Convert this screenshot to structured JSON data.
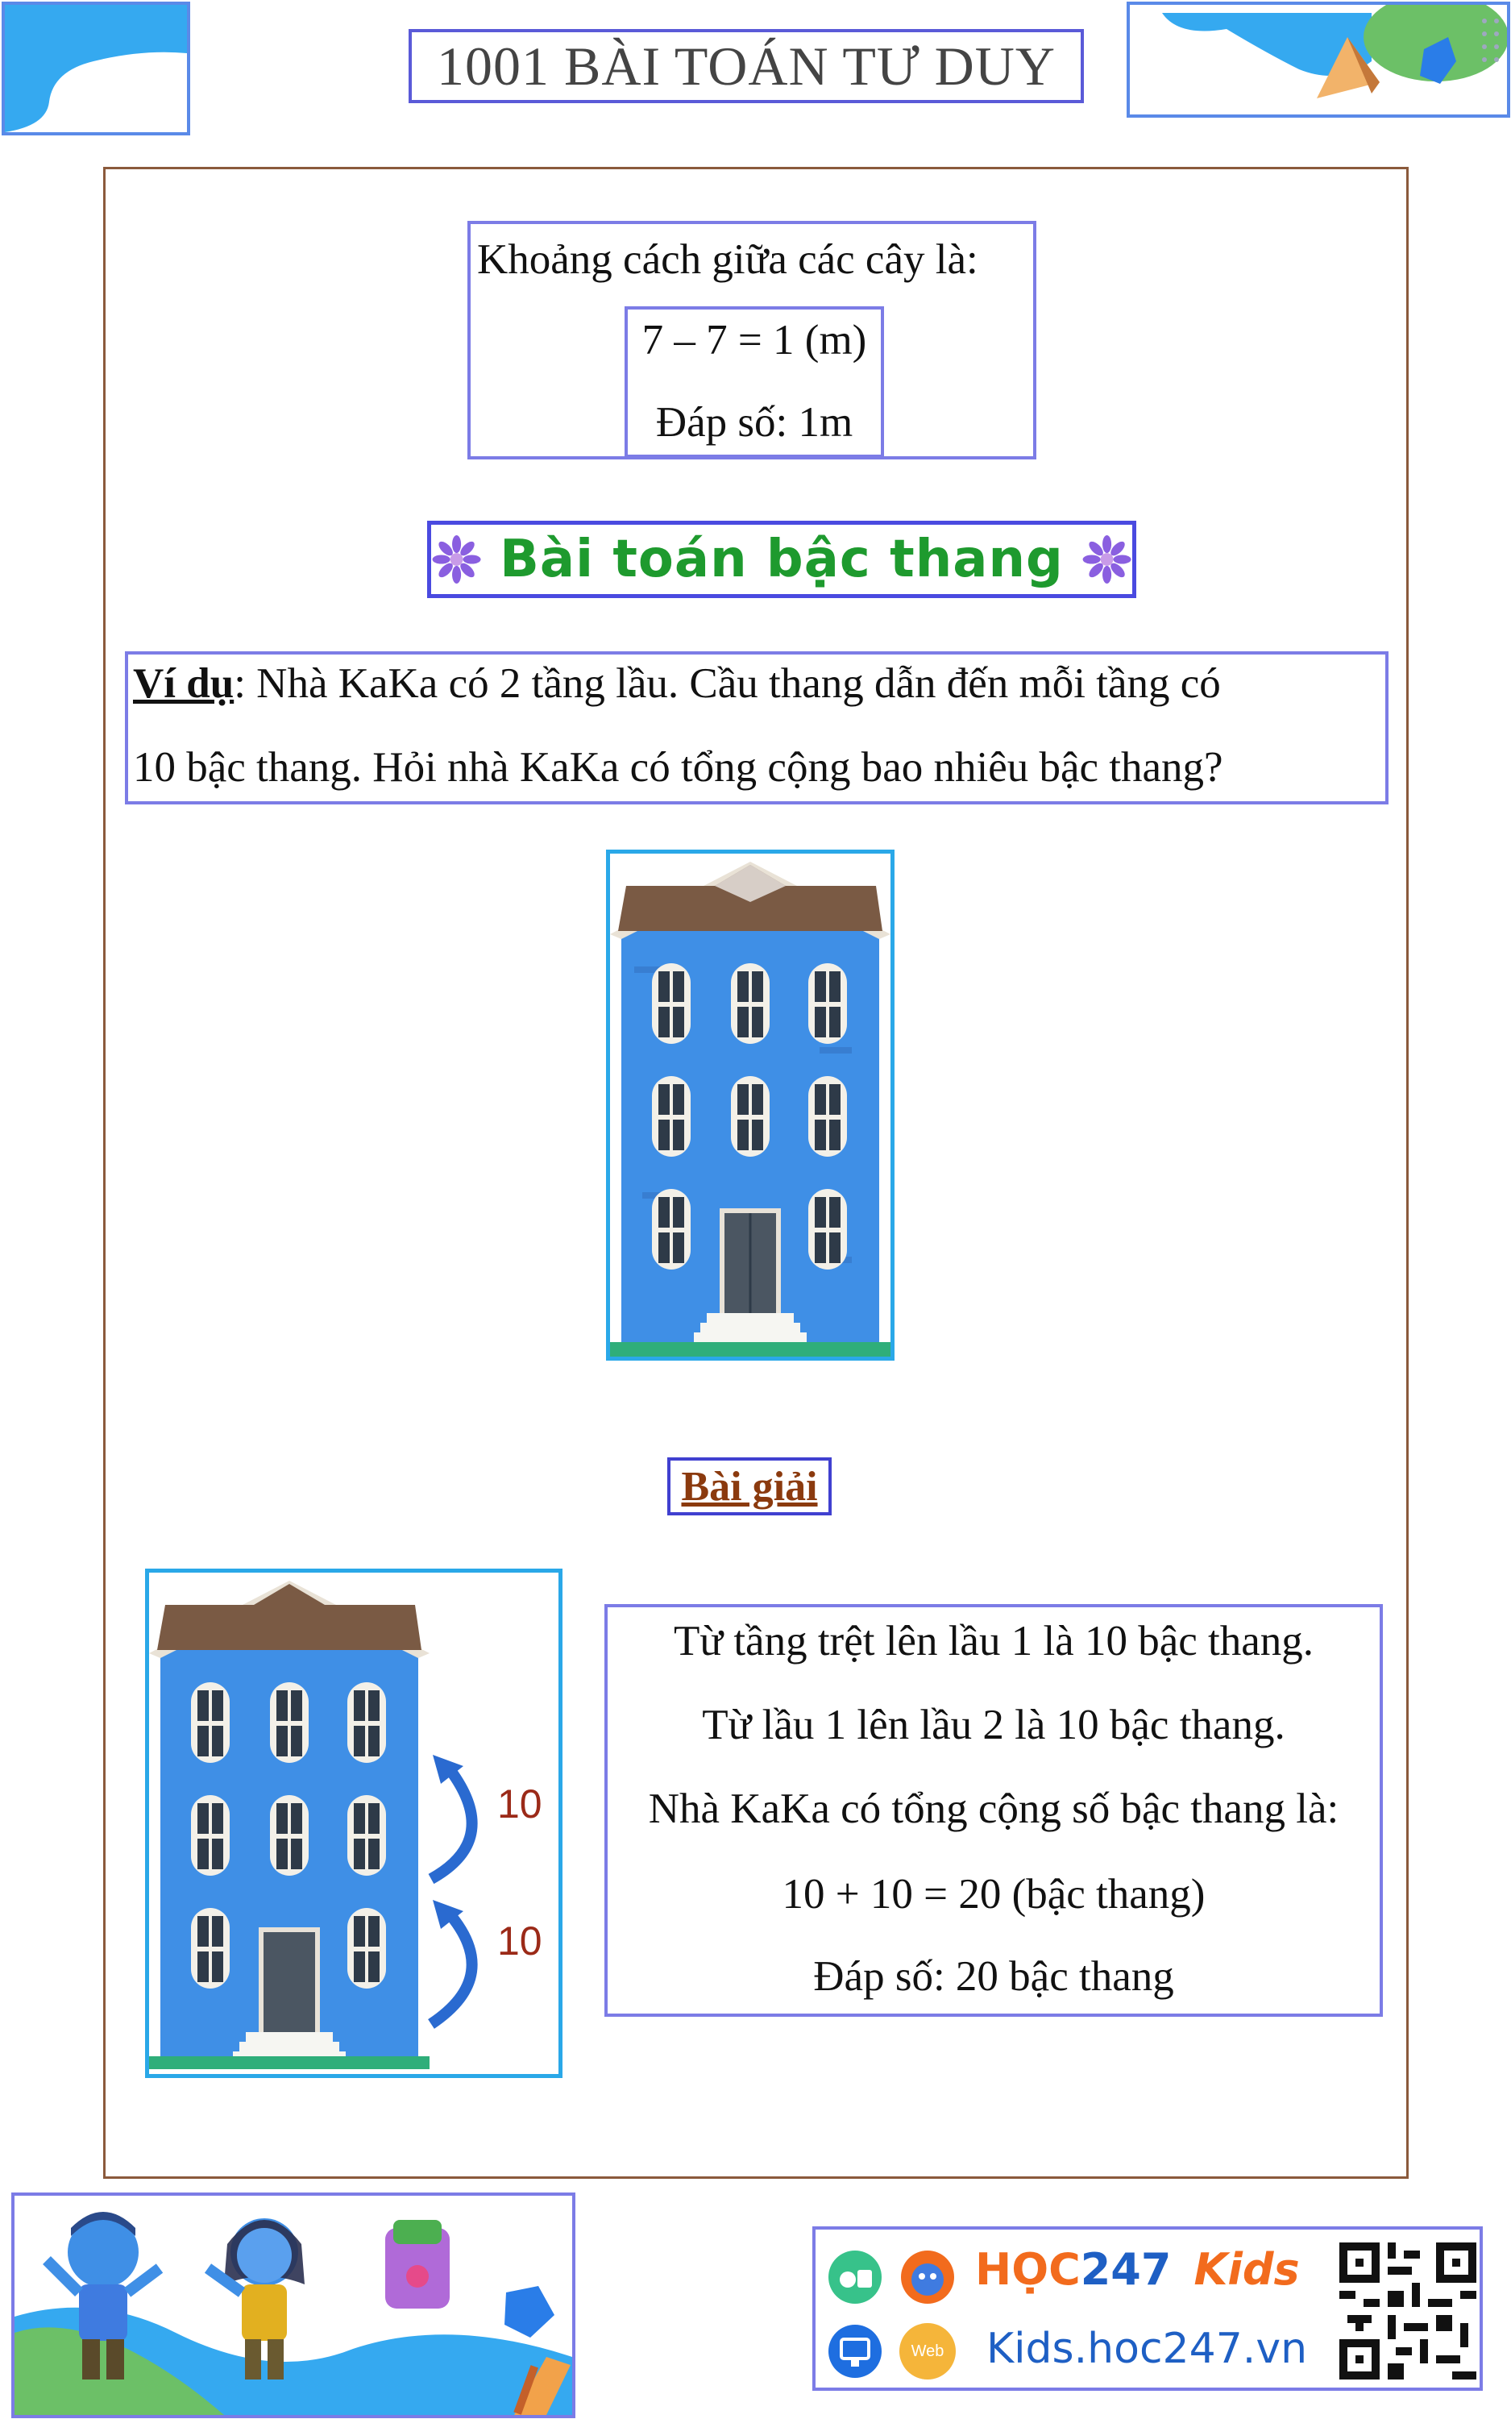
{
  "header": {
    "title": "1001 BÀI TOÁN TƯ DUY"
  },
  "previous_answer": {
    "line1": "Khoảng cách giữa các cây là:",
    "line2": "7 – 7 = 1 (m)",
    "line3": "Đáp số: 1m"
  },
  "section": {
    "title": "Bài toán bậc thang"
  },
  "example": {
    "label": "Ví dụ",
    "line1_rest": ": Nhà KaKa có 2 tầng lầu. Cầu thang dẫn đến mỗi tầng có",
    "line2": "10 bậc thang. Hỏi nhà KaKa có tổng cộng bao nhiêu bậc thang?"
  },
  "solution": {
    "title": "Bài giải",
    "lines": [
      "Từ tầng trệt lên lầu 1 là 10 bậc thang.",
      "Từ lầu 1 lên lầu 2 là 10 bậc thang.",
      "Nhà KaKa có tổng cộng số bậc thang là:",
      "10 + 10 = 20 (bậc thang)",
      "Đáp số: 20 bậc thang"
    ],
    "arrow_labels": [
      "10",
      "10"
    ]
  },
  "footer": {
    "brand_hoc": "HỌC",
    "brand_247": "247",
    "brand_kids": "Kids",
    "site": "Kids.hoc247.vn",
    "web_badge": "Web"
  },
  "colors": {
    "detection_box": "#7c7ce6",
    "section_title": "#1e9a2e",
    "solution_title": "#8b3a0e",
    "frame": "#8b5a3c",
    "building": "#3f8fe6",
    "roof": "#7a5a44",
    "brand_orange": "#f26b1d",
    "brand_blue": "#1e5fc4"
  }
}
